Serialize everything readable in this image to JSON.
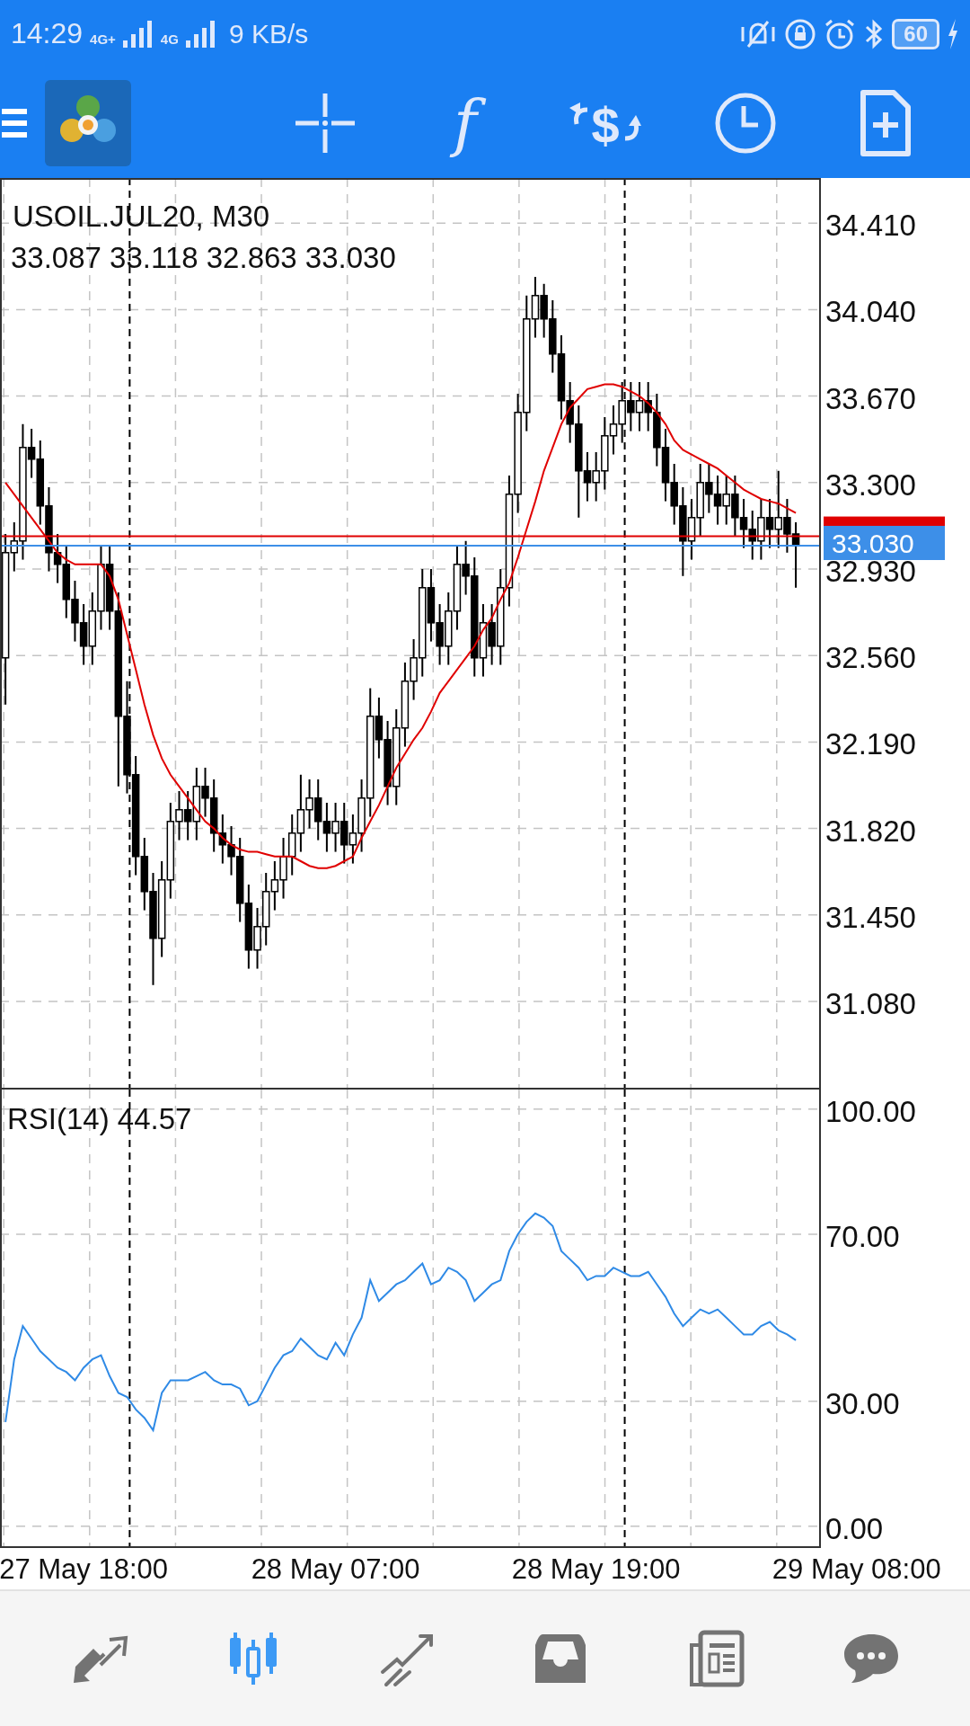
{
  "status_bar": {
    "time": "14:29",
    "network_1": "4G+",
    "network_2": "4G",
    "speed": "9 KB/s",
    "battery": "60"
  },
  "toolbar": {
    "function_icon": "f",
    "currency_icon": "$"
  },
  "chart": {
    "symbol": "USOIL.JUL20, M30",
    "quote": "33.087 33.118 32.863 33.030",
    "price_tag": "33.030",
    "chart_data": {
      "type": "candlestick",
      "grid": true,
      "categories": [
        null,
        null,
        null,
        null,
        null,
        null,
        null,
        null,
        null,
        null,
        null,
        null,
        null,
        null,
        null,
        null,
        null,
        null,
        null,
        null,
        null,
        null,
        null,
        null,
        null,
        null,
        null,
        null,
        null,
        null,
        null,
        null,
        null,
        null,
        null,
        null,
        null,
        null,
        null,
        null,
        null,
        null,
        null,
        null,
        null,
        null,
        null,
        null,
        null,
        null,
        null,
        null,
        null,
        null,
        null,
        null,
        null,
        null,
        null,
        null,
        null,
        null,
        null,
        null,
        null,
        null,
        null,
        null,
        null,
        null,
        null,
        null,
        null,
        null,
        null,
        null,
        null,
        null,
        null,
        null,
        null,
        null,
        null,
        null,
        null,
        null,
        null,
        null,
        null,
        null,
        null,
        null
      ],
      "ylim": [
        30.703,
        34.603
      ],
      "yticks": [
        {
          "value": 34.41,
          "label": "34.410"
        },
        {
          "value": 34.04,
          "label": "34.040"
        },
        {
          "value": 33.67,
          "label": "33.670"
        },
        {
          "value": 33.3,
          "label": "33.300"
        },
        {
          "value": 32.93,
          "label": "32.930"
        },
        {
          "value": 32.56,
          "label": "32.560"
        },
        {
          "value": 32.19,
          "label": "32.190"
        },
        {
          "value": 31.82,
          "label": "31.820"
        },
        {
          "value": 31.45,
          "label": "31.450"
        },
        {
          "value": 31.08,
          "label": "31.080"
        }
      ],
      "ohlc": [
        [
          32.55,
          33.08,
          32.35,
          33.0
        ],
        [
          33.0,
          33.13,
          32.92,
          33.05
        ],
        [
          33.05,
          33.55,
          32.97,
          33.45
        ],
        [
          33.45,
          33.53,
          33.32,
          33.4
        ],
        [
          33.4,
          33.48,
          33.12,
          33.2
        ],
        [
          33.2,
          33.28,
          32.92,
          33.0
        ],
        [
          33.0,
          33.08,
          32.87,
          32.95
        ],
        [
          32.95,
          33.03,
          32.72,
          32.8
        ],
        [
          32.8,
          32.88,
          32.62,
          32.7
        ],
        [
          32.7,
          32.78,
          32.52,
          32.6
        ],
        [
          32.6,
          32.83,
          32.52,
          32.75
        ],
        [
          32.75,
          33.03,
          32.67,
          32.95
        ],
        [
          32.95,
          33.03,
          32.67,
          32.75
        ],
        [
          32.75,
          32.83,
          32.0,
          32.3
        ],
        [
          32.3,
          32.45,
          31.97,
          32.05
        ],
        [
          32.05,
          32.13,
          31.62,
          31.7
        ],
        [
          31.7,
          31.78,
          31.47,
          31.55
        ],
        [
          31.55,
          31.63,
          31.15,
          31.35
        ],
        [
          31.35,
          31.68,
          31.27,
          31.6
        ],
        [
          31.6,
          31.93,
          31.52,
          31.85
        ],
        [
          31.85,
          31.98,
          31.77,
          31.9
        ],
        [
          31.9,
          31.98,
          31.77,
          31.85
        ],
        [
          31.85,
          32.08,
          31.77,
          32.0
        ],
        [
          32.0,
          32.08,
          31.87,
          31.95
        ],
        [
          31.95,
          32.03,
          31.72,
          31.8
        ],
        [
          31.8,
          31.88,
          31.67,
          31.75
        ],
        [
          31.75,
          31.83,
          31.62,
          31.7
        ],
        [
          31.7,
          31.78,
          31.42,
          31.5
        ],
        [
          31.5,
          31.58,
          31.22,
          31.3
        ],
        [
          31.3,
          31.48,
          31.22,
          31.4
        ],
        [
          31.4,
          31.63,
          31.32,
          31.55
        ],
        [
          31.55,
          31.68,
          31.47,
          31.6
        ],
        [
          31.6,
          31.78,
          31.52,
          31.7
        ],
        [
          31.7,
          31.88,
          31.62,
          31.8
        ],
        [
          31.8,
          32.05,
          31.72,
          31.9
        ],
        [
          31.9,
          32.03,
          31.82,
          31.95
        ],
        [
          31.95,
          32.03,
          31.77,
          31.85
        ],
        [
          31.85,
          31.93,
          31.72,
          31.8
        ],
        [
          31.8,
          31.93,
          31.72,
          31.85
        ],
        [
          31.85,
          31.93,
          31.67,
          31.75
        ],
        [
          31.75,
          31.88,
          31.67,
          31.8
        ],
        [
          31.8,
          32.03,
          31.72,
          31.95
        ],
        [
          31.95,
          32.42,
          31.87,
          32.3
        ],
        [
          32.3,
          32.38,
          32.12,
          32.2
        ],
        [
          32.2,
          32.28,
          31.92,
          32.0
        ],
        [
          32.0,
          32.33,
          31.92,
          32.25
        ],
        [
          32.25,
          32.53,
          32.17,
          32.45
        ],
        [
          32.45,
          32.63,
          32.37,
          32.55
        ],
        [
          32.55,
          32.93,
          32.47,
          32.85
        ],
        [
          32.85,
          32.93,
          32.62,
          32.7
        ],
        [
          32.7,
          32.78,
          32.52,
          32.6
        ],
        [
          32.6,
          32.83,
          32.52,
          32.75
        ],
        [
          32.75,
          33.03,
          32.67,
          32.95
        ],
        [
          32.95,
          33.05,
          32.82,
          32.9
        ],
        [
          32.9,
          32.98,
          32.47,
          32.55
        ],
        [
          32.55,
          32.78,
          32.47,
          32.7
        ],
        [
          32.7,
          32.78,
          32.52,
          32.6
        ],
        [
          32.6,
          32.93,
          32.52,
          32.85
        ],
        [
          32.85,
          33.33,
          32.77,
          33.25
        ],
        [
          33.25,
          33.68,
          33.17,
          33.6
        ],
        [
          33.6,
          34.1,
          33.52,
          34.0
        ],
        [
          34.0,
          34.18,
          33.92,
          34.1
        ],
        [
          34.1,
          34.15,
          33.92,
          34.0
        ],
        [
          34.0,
          34.08,
          33.77,
          33.85
        ],
        [
          33.85,
          33.93,
          33.57,
          33.65
        ],
        [
          33.65,
          33.73,
          33.47,
          33.55
        ],
        [
          33.55,
          33.63,
          33.15,
          33.35
        ],
        [
          33.35,
          33.43,
          33.22,
          33.3
        ],
        [
          33.3,
          33.43,
          33.22,
          33.35
        ],
        [
          33.35,
          33.58,
          33.27,
          33.5
        ],
        [
          33.5,
          33.63,
          33.42,
          33.55
        ],
        [
          33.55,
          33.73,
          33.47,
          33.65
        ],
        [
          33.65,
          33.73,
          33.52,
          33.6
        ],
        [
          33.6,
          33.73,
          33.52,
          33.65
        ],
        [
          33.65,
          33.73,
          33.52,
          33.6
        ],
        [
          33.6,
          33.68,
          33.37,
          33.45
        ],
        [
          33.45,
          33.53,
          33.22,
          33.3
        ],
        [
          33.3,
          33.38,
          33.12,
          33.2
        ],
        [
          33.2,
          33.28,
          32.9,
          33.05
        ],
        [
          33.05,
          33.23,
          32.97,
          33.15
        ],
        [
          33.15,
          33.38,
          33.07,
          33.3
        ],
        [
          33.3,
          33.38,
          33.17,
          33.25
        ],
        [
          33.25,
          33.33,
          33.12,
          33.2
        ],
        [
          33.2,
          33.33,
          33.12,
          33.25
        ],
        [
          33.25,
          33.33,
          33.07,
          33.15
        ],
        [
          33.15,
          33.23,
          33.02,
          33.1
        ],
        [
          33.1,
          33.18,
          32.97,
          33.05
        ],
        [
          33.05,
          33.23,
          32.97,
          33.15
        ],
        [
          33.15,
          33.23,
          33.02,
          33.1
        ],
        [
          33.1,
          33.35,
          33.02,
          33.15
        ],
        [
          33.15,
          33.23,
          33.0,
          33.08
        ],
        [
          33.08,
          33.13,
          32.85,
          33.03
        ]
      ],
      "series": [
        {
          "type": "line",
          "color": "#e00000",
          "values": [
            33.3,
            33.25,
            33.2,
            33.15,
            33.1,
            33.05,
            33.0,
            32.97,
            32.95,
            32.95,
            32.95,
            32.95,
            32.9,
            32.8,
            32.65,
            32.5,
            32.35,
            32.22,
            32.12,
            32.05,
            32.0,
            31.95,
            31.9,
            31.85,
            31.82,
            31.78,
            31.75,
            31.73,
            31.72,
            31.72,
            31.71,
            31.7,
            31.7,
            31.7,
            31.68,
            31.66,
            31.65,
            31.65,
            31.66,
            31.68,
            31.7,
            31.78,
            31.85,
            31.92,
            32.0,
            32.08,
            32.14,
            32.2,
            32.25,
            32.32,
            32.4,
            32.45,
            32.5,
            32.55,
            32.6,
            32.67,
            32.72,
            32.8,
            32.87,
            32.98,
            33.1,
            33.22,
            33.35,
            33.45,
            33.55,
            33.62,
            33.66,
            33.7,
            33.71,
            33.72,
            33.72,
            33.71,
            33.69,
            33.67,
            33.64,
            33.6,
            33.55,
            33.48,
            33.44,
            33.42,
            33.4,
            33.38,
            33.36,
            33.33,
            33.3,
            33.27,
            33.25,
            33.23,
            33.22,
            33.21,
            33.19,
            33.17
          ]
        }
      ],
      "ref_lines": [
        {
          "axis": "y",
          "value": 33.07,
          "color": "#e00000"
        },
        {
          "axis": "y",
          "value": 33.03,
          "color": "#3d8fe8"
        }
      ]
    }
  },
  "indicator": {
    "label": "RSI(14) 44.57",
    "chart_data": {
      "type": "line",
      "grid": true,
      "categories": [
        null,
        null,
        null,
        null,
        null,
        null,
        null,
        null,
        null,
        "27 May 18:00",
        null,
        null,
        null,
        null,
        null,
        null,
        null,
        null,
        null,
        null,
        null,
        null,
        null,
        null,
        null,
        null,
        null,
        null,
        null,
        null,
        null,
        null,
        null,
        null,
        null,
        null,
        null,
        null,
        "28 May 07:00",
        null,
        null,
        null,
        null,
        null,
        null,
        null,
        null,
        null,
        null,
        null,
        null,
        null,
        null,
        null,
        null,
        null,
        null,
        null,
        null,
        null,
        null,
        null,
        null,
        null,
        null,
        null,
        null,
        null,
        "28 May 19:00",
        null,
        null,
        null,
        null,
        null,
        null,
        null,
        null,
        null,
        null,
        null,
        null,
        null,
        null,
        null,
        null,
        null,
        null,
        null,
        null,
        null,
        null,
        null,
        null,
        null,
        null,
        null,
        null,
        null,
        "29 May 08:00"
      ],
      "ylim": [
        -5.2,
        104.7
      ],
      "yticks": [
        {
          "value": 100,
          "label": "100.00"
        },
        {
          "value": 70,
          "label": "70.00"
        },
        {
          "value": 30,
          "label": "30.00"
        },
        {
          "value": 0,
          "label": "0.00"
        }
      ],
      "series": [
        {
          "color": "#2f8ae6",
          "values": [
            25,
            40,
            48,
            45,
            42,
            40,
            38,
            37,
            35,
            38,
            40,
            41,
            36,
            32,
            31,
            28,
            26,
            23,
            32,
            35,
            35,
            35,
            36,
            37,
            35,
            34,
            34,
            33,
            29,
            30,
            34,
            38,
            41,
            42,
            45,
            43,
            41,
            40,
            44,
            41,
            46,
            50,
            59,
            54,
            56,
            58,
            59,
            61,
            63,
            58,
            59,
            62,
            61,
            59,
            54,
            56,
            58,
            59,
            66,
            70,
            73,
            75,
            74,
            72,
            66,
            64,
            62,
            59,
            60,
            60,
            62,
            61,
            60,
            60,
            61,
            58,
            55,
            51,
            48,
            50,
            52,
            51,
            52,
            50,
            48,
            46,
            46,
            48,
            49,
            47,
            46,
            44.6,
            null,
            null,
            null,
            null,
            null,
            null,
            null
          ]
        }
      ]
    }
  },
  "bottom_nav": [
    {
      "kind": "arrows",
      "selected": false
    },
    {
      "kind": "candles",
      "selected": true
    },
    {
      "kind": "trend",
      "selected": false
    },
    {
      "kind": "inbox",
      "selected": false
    },
    {
      "kind": "newspaper",
      "selected": false
    },
    {
      "kind": "chat",
      "selected": false
    }
  ]
}
